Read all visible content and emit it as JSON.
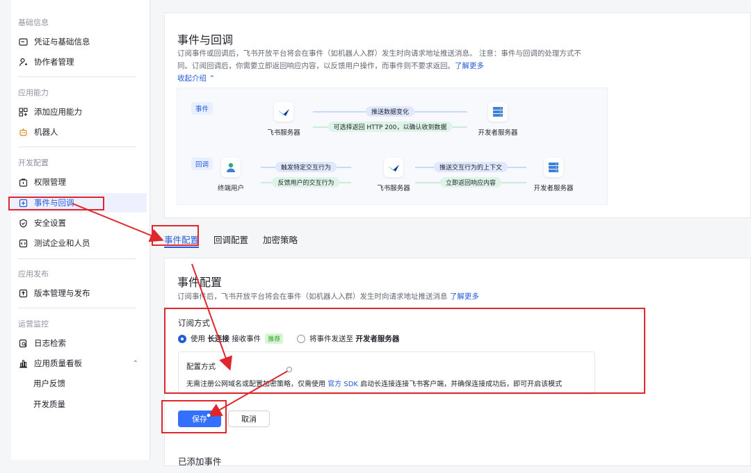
{
  "sidebar": {
    "groups": [
      {
        "title": "基础信息",
        "items": [
          "凭证与基础信息",
          "协作者管理"
        ]
      },
      {
        "title": "应用能力",
        "items": [
          "添加应用能力",
          "机器人"
        ]
      },
      {
        "title": "开发配置",
        "items": [
          "权限管理",
          "事件与回调",
          "安全设置",
          "测试企业和人员"
        ]
      },
      {
        "title": "应用发布",
        "items": [
          "版本管理与发布"
        ]
      },
      {
        "title": "运营监控",
        "items": [
          "日志检索",
          "应用质量看板",
          "用户反馈",
          "开发质量"
        ]
      }
    ]
  },
  "intro": {
    "title": "事件与回调",
    "desc_line1": "订阅事件或回调后，飞书开放平台将会在事件（如机器人入群）发生时向请求地址推送消息。 注意：事件与回调的处理方式不",
    "desc_line2": "同。订阅回调后，你需要立即返回响应内容，以反馈用户操作，而事件则不要求返回。",
    "learn_more": "了解更多",
    "collapse": "收起介绍 ⌃"
  },
  "diagram": {
    "event_tag": "事件",
    "callback_tag": "回调",
    "feishu_server": "飞书服务器",
    "dev_server": "开发者服务器",
    "end_user": "终端用户",
    "push_data_change": "推送数据变化",
    "optional_return": "可选择返回 HTTP 200，以确认收到数据",
    "trigger_interaction": "触发特定交互行为",
    "feedback_interaction": "反馈用户的交互行为",
    "push_context": "推送交互行为的上下文",
    "return_response": "立即返回响应内容"
  },
  "tabs": [
    "事件配置",
    "回调配置",
    "加密策略"
  ],
  "event_config": {
    "title": "事件配置",
    "desc": "订阅事件后，飞书开放平台将会在事件（如机器人入群）发生时向请求地址推送消息",
    "learn_more": "了解更多",
    "subscribe_label": "订阅方式",
    "option1_prefix": "使用",
    "option1_bold": "长连接",
    "option1_suffix": "接收事件",
    "recommended": "推荐",
    "option2_prefix": "将事件发送至",
    "option2_bold": "开发者服务器",
    "config_label": "配置方式",
    "config_desc_prefix": "无需注册公网域名或配置加密策略，仅需使用",
    "config_sdk": "官方 SDK",
    "config_desc_suffix": "启动长连接连接飞书客户端，并确保连接成功后，即可开启该模式"
  },
  "buttons": {
    "save": "保存",
    "cancel": "取消"
  },
  "added_events": "已添加事件",
  "colors": {
    "accent": "#3370ff",
    "annotation": "#e0262d"
  }
}
